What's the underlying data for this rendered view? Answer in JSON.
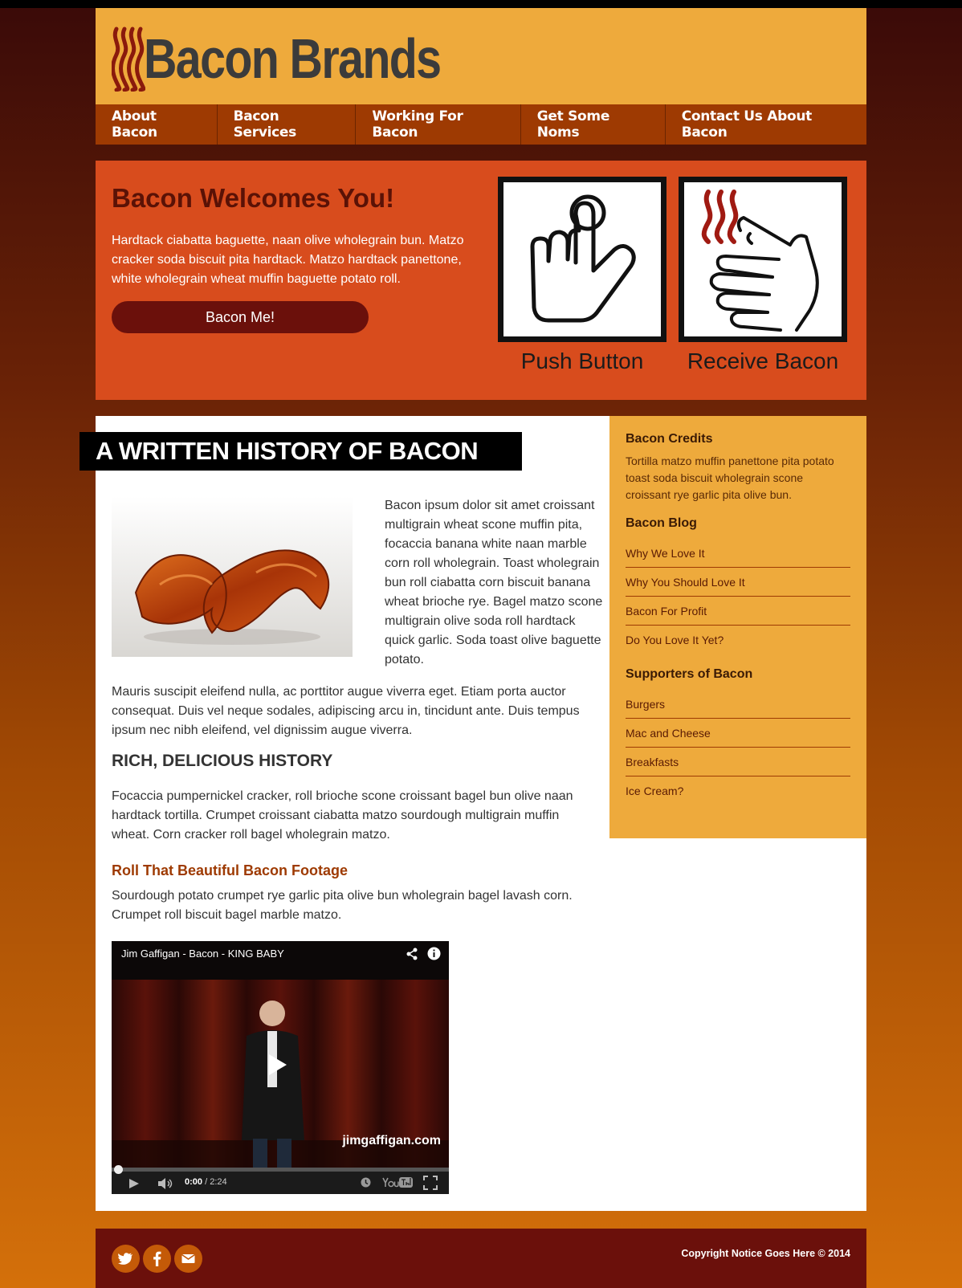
{
  "brand": {
    "name": "Bacon Brands"
  },
  "nav": {
    "items": [
      "About Bacon",
      "Bacon Services",
      "Working For Bacon",
      "Get Some Noms",
      "Contact Us About Bacon"
    ]
  },
  "hero": {
    "title": "Bacon Welcomes You!",
    "text": "Hardtack ciabatta baguette, naan olive wholegrain bun. Matzo cracker soda biscuit pita hardtack. Matzo hardtack panettone, white wholegrain wheat muffin baguette potato roll.",
    "button": "Bacon Me!",
    "steps": [
      {
        "label": "Push Button",
        "icon": "pointing-hand-icon"
      },
      {
        "label": "Receive Bacon",
        "icon": "receive-bacon-hands-icon"
      }
    ]
  },
  "article": {
    "banner": "A WRITTEN HISTORY OF BACON",
    "intro": "Bacon ipsum dolor sit amet croissant multigrain wheat scone muffin pita, focaccia banana white naan marble corn roll wholegrain. Toast wholegrain bun roll ciabatta corn biscuit banana wheat brioche rye. Bagel matzo scone multigrain olive soda roll hardtack quick garlic. Soda toast olive baguette potato.",
    "para2": "Mauris suscipit eleifend nulla, ac porttitor augue viverra eget. Etiam porta auctor consequat. Duis vel neque sodales, adipiscing arcu in, tincidunt ante. Duis tempus ipsum nec nibh eleifend, vel dignissim augue viverra.",
    "heading2": "RICH, DELICIOUS HISTORY",
    "para3": "Focaccia pumpernickel cracker, roll brioche scone croissant bagel bun olive naan hardtack tortilla. Crumpet croissant ciabatta matzo sourdough multigrain muffin wheat. Corn cracker roll bagel wholegrain matzo.",
    "heading3": "Roll That Beautiful Bacon Footage",
    "para4": "Sourdough potato crumpet rye garlic pita olive bun wholegrain bagel lavash corn. Crumpet roll biscuit bagel marble matzo."
  },
  "video": {
    "title": "Jim Gaffigan - Bacon - KING BABY",
    "watermark": "jimgaffigan.com",
    "time_current": "0:00",
    "time_total": " / 2:24",
    "progress": 0
  },
  "sidebar": {
    "credits_title": "Bacon Credits",
    "credits_text": "Tortilla matzo muffin panettone pita potato toast soda biscuit wholegrain scone croissant rye garlic pita olive bun.",
    "blog_title": "Bacon Blog",
    "blog_items": [
      "Why We Love It",
      "Why You Should Love It",
      "Bacon For Profit",
      "Do You Love It Yet?"
    ],
    "supporters_title": "Supporters of Bacon",
    "supporters_items": [
      "Burgers",
      "Mac and Cheese",
      "Breakfasts",
      "Ice Cream?"
    ]
  },
  "footer": {
    "copyright": "Copyright Notice Goes Here © 2014",
    "social": [
      "twitter-icon",
      "facebook-icon",
      "email-icon"
    ]
  },
  "colors": {
    "header_bg": "#eeaa3c",
    "nav_bg": "#9e3a02",
    "hero_bg": "#d84c1d",
    "button_bg": "#6b100b",
    "footer_bg": "#6b100b",
    "accent": "#9e3a02"
  }
}
